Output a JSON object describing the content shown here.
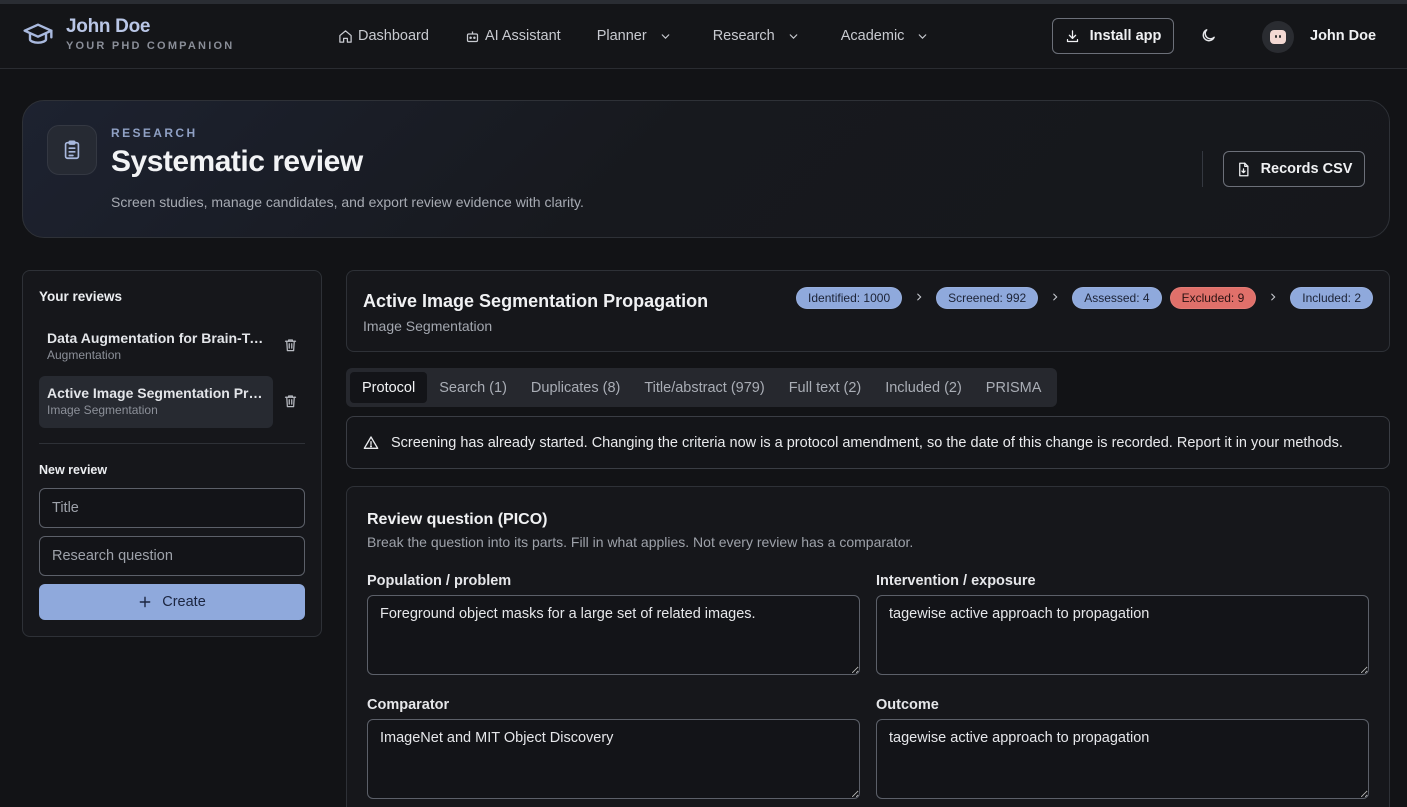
{
  "nav": {
    "brand_name": "John Doe",
    "brand_tagline": "YOUR PHD COMPANION",
    "items": [
      {
        "label": "Dashboard",
        "icon": "home-icon"
      },
      {
        "label": "AI Assistant",
        "icon": "bot-icon"
      },
      {
        "label": "Planner",
        "icon": "chevron-down-icon"
      },
      {
        "label": "Research",
        "icon": "chevron-down-icon"
      },
      {
        "label": "Academic",
        "icon": "chevron-down-icon"
      }
    ],
    "install_label": "Install app",
    "user_name": "John Doe"
  },
  "hero": {
    "kicker": "RESEARCH",
    "title": "Systematic review",
    "subtitle": "Screen studies, manage candidates, and export review evidence with clarity.",
    "export_label": "Records CSV"
  },
  "sidebar": {
    "heading": "Your reviews",
    "reviews": [
      {
        "title": "Data Augmentation for Brain-Tumor Segmentation",
        "tag": "Augmentation"
      },
      {
        "title": "Active Image Segmentation Propagation",
        "tag": "Image Segmentation"
      }
    ],
    "new_heading": "New review",
    "title_placeholder": "Title",
    "question_placeholder": "Research question",
    "create_label": "Create"
  },
  "review": {
    "title": "Active Image Segmentation Propagation",
    "subtitle": "Image Segmentation",
    "counts": {
      "identified": "Identified: 1000",
      "screened": "Screened: 992",
      "assessed": "Assessed: 4",
      "excluded": "Excluded: 9",
      "included": "Included: 2"
    }
  },
  "tabs": [
    "Protocol",
    "Search (1)",
    "Duplicates (8)",
    "Title/abstract (979)",
    "Full text (2)",
    "Included (2)",
    "PRISMA"
  ],
  "alert": "Screening has already started. Changing the criteria now is a protocol amendment, so the date of this change is recorded. Report it in your methods.",
  "pico": {
    "title": "Review question (PICO)",
    "subtitle": "Break the question into its parts. Fill in what applies. Not every review has a comparator.",
    "population_label": "Population / problem",
    "population_value": "Foreground object masks for a large set of related images.",
    "intervention_label": "Intervention / exposure",
    "intervention_value": "tagewise active approach to propagation",
    "comparator_label": "Comparator",
    "comparator_value": "ImageNet and MIT Object Discovery",
    "outcome_label": "Outcome",
    "outcome_value": "tagewise active approach to propagation"
  },
  "colors": {
    "accent": "#8fa9dc",
    "danger": "#e0706a",
    "background": "#121316"
  }
}
